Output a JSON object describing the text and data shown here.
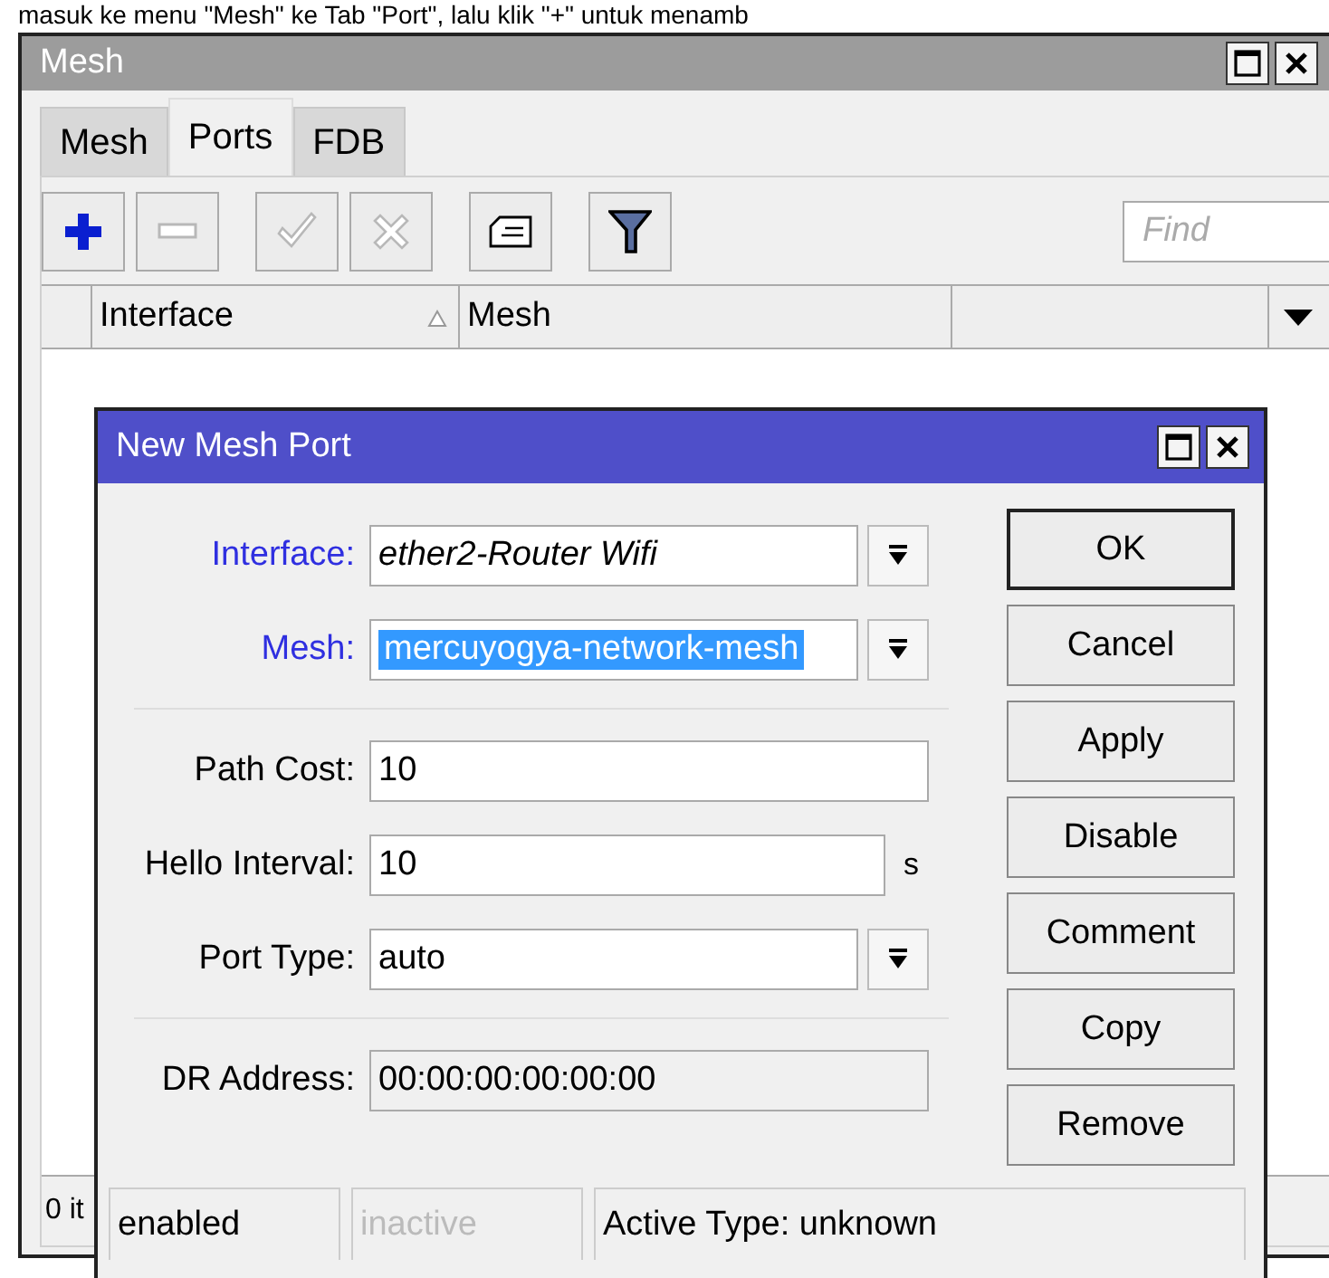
{
  "page_text": "masuk ke menu \"Mesh\" ke Tab \"Port\", lalu klik \"+\" untuk menamb",
  "window": {
    "title": "Mesh"
  },
  "tabs": [
    {
      "label": "Mesh",
      "selected": false
    },
    {
      "label": "Ports",
      "selected": true
    },
    {
      "label": "FDB",
      "selected": false
    }
  ],
  "toolbar": {
    "buttons": [
      {
        "kind": "add",
        "disabled": false
      },
      {
        "kind": "remove",
        "disabled": true
      },
      {
        "kind": "enable",
        "disabled": true
      },
      {
        "kind": "disable",
        "disabled": true
      },
      {
        "kind": "comment",
        "disabled": false
      },
      {
        "kind": "filter",
        "disabled": false
      }
    ],
    "find": {
      "placeholder": "Find"
    }
  },
  "table": {
    "columns": [
      {
        "label": "Interface",
        "sorted": true
      },
      {
        "label": "Mesh",
        "sorted": false
      }
    ]
  },
  "status_bar": "0 it",
  "dialog": {
    "title": "New Mesh Port",
    "field_groups": [
      [
        {
          "label": "Interface:",
          "value": "ether2-Router Wifi",
          "kind": "dropdown",
          "highlighted": true,
          "italic": true,
          "selected": false
        },
        {
          "label": "Mesh:",
          "value": "mercuyogya-network-mesh",
          "kind": "dropdown",
          "highlighted": true,
          "italic": false,
          "selected": true
        }
      ],
      [
        {
          "label": "Path Cost:",
          "value": "10",
          "kind": "text",
          "highlighted": false,
          "italic": false,
          "selected": false
        },
        {
          "label": "Hello Interval:",
          "value": "10",
          "unit": "s",
          "kind": "text",
          "highlighted": false,
          "italic": false,
          "selected": false
        },
        {
          "label": "Port Type:",
          "value": "auto",
          "kind": "dropdown",
          "highlighted": false,
          "italic": false,
          "selected": false
        }
      ],
      [
        {
          "label": "DR Address:",
          "value": "00:00:00:00:00:00",
          "kind": "readonly",
          "highlighted": false,
          "italic": false,
          "selected": false
        }
      ]
    ],
    "buttons": [
      {
        "label": "OK",
        "default": true
      },
      {
        "label": "Cancel",
        "default": false
      },
      {
        "label": "Apply",
        "default": false
      },
      {
        "label": "Disable",
        "default": false
      },
      {
        "label": "Comment",
        "default": false
      },
      {
        "label": "Copy",
        "default": false
      },
      {
        "label": "Remove",
        "default": false
      }
    ],
    "status": [
      {
        "text": "enabled",
        "disabled": false
      },
      {
        "text": "inactive",
        "disabled": true
      },
      {
        "text": "Active Type: unknown",
        "disabled": false
      }
    ]
  }
}
